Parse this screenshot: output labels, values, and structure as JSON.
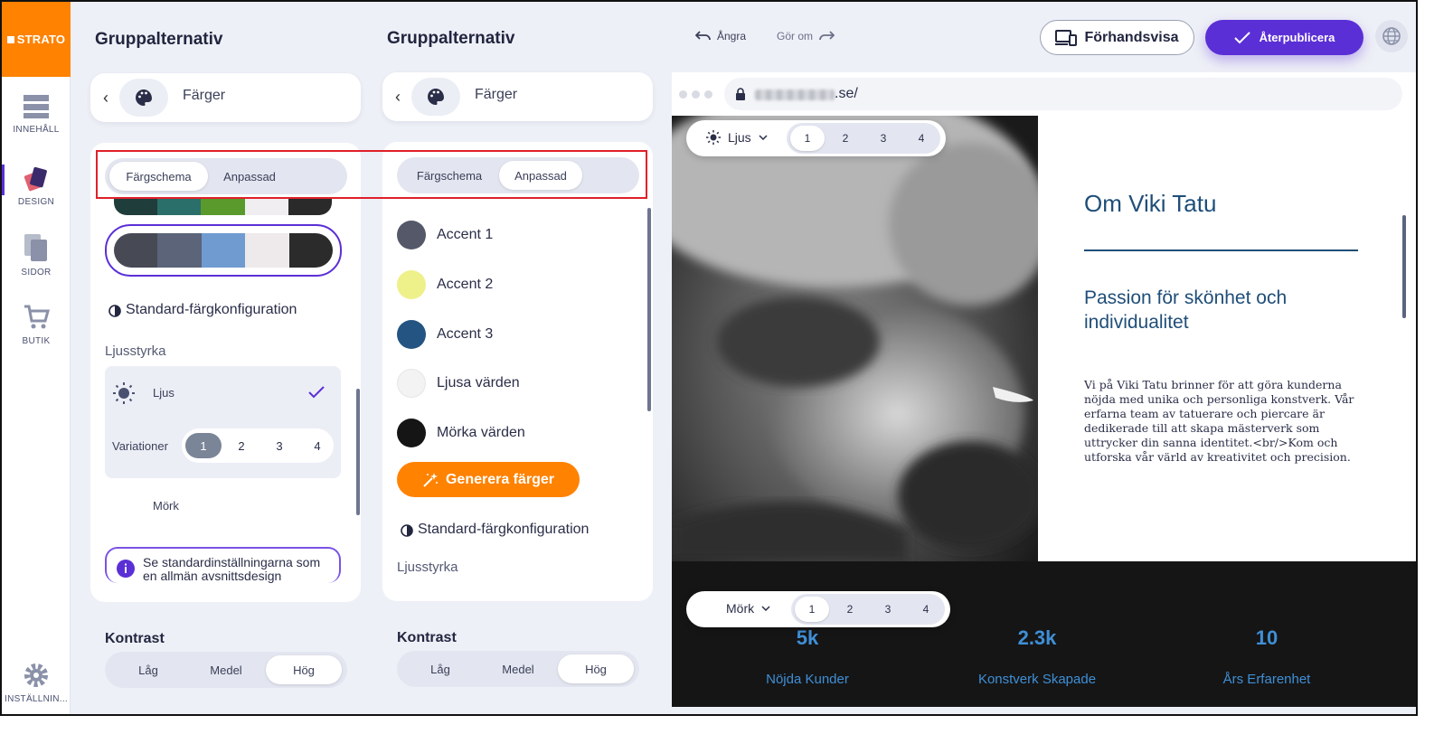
{
  "nav": {
    "logo": "STRATO",
    "items": [
      {
        "label": "INNEHÅLL"
      },
      {
        "label": "DESIGN"
      },
      {
        "label": "SIDOR"
      },
      {
        "label": "BUTIK"
      },
      {
        "label": "INSTÄLLNIN..."
      }
    ]
  },
  "left_panel": {
    "title": "Gruppalternativ",
    "back_label": "Färger",
    "tabs": [
      "Färgschema",
      "Anpassad"
    ],
    "active_tab": "Färgschema",
    "palette_top": [
      "#1f3d3b",
      "#2b6f6a",
      "#5a9a2c",
      "#f0eef0",
      "#2a2a2a"
    ],
    "palette_selected": [
      "#474a55",
      "#5b6478",
      "#6f9bd1",
      "#eee9ea",
      "#2b2b2b"
    ],
    "std_config": "Standard-färgkonfiguration",
    "brightness_label": "Ljusstyrka",
    "light_label": "Ljus",
    "variations_label": "Variationer",
    "variations": [
      "1",
      "2",
      "3",
      "4"
    ],
    "active_variation": "1",
    "dark_label": "Mörk",
    "info_text": "Se standardinställningarna som en allmän avsnittsdesign",
    "contrast_label": "Kontrast",
    "contrast_options": [
      "Låg",
      "Medel",
      "Hög"
    ],
    "active_contrast": "Hög"
  },
  "mid_panel": {
    "title": "Gruppalternativ",
    "back_label": "Färger",
    "tabs": [
      "Färgschema",
      "Anpassad"
    ],
    "active_tab": "Anpassad",
    "accents": [
      {
        "label": "Accent 1",
        "color": "#545869"
      },
      {
        "label": "Accent 2",
        "color": "#eef08a"
      },
      {
        "label": "Accent 3",
        "color": "#245482"
      },
      {
        "label": "Ljusa värden",
        "color": "#f3f3f3"
      },
      {
        "label": "Mörka värden",
        "color": "#151515"
      }
    ],
    "generate_label": "Generera färger",
    "std_config": "Standard-färgkonfiguration",
    "brightness_label": "Ljusstyrka",
    "contrast_label": "Kontrast",
    "contrast_options": [
      "Låg",
      "Medel",
      "Hög"
    ],
    "active_contrast": "Hög"
  },
  "topbar": {
    "undo": "Ångra",
    "redo": "Gör om",
    "preview": "Förhandsvisa",
    "publish": "Återpublicera"
  },
  "browser": {
    "url_suffix": ".se/"
  },
  "site": {
    "light_mode": {
      "label": "Ljus",
      "variations": [
        "1",
        "2",
        "3",
        "4"
      ],
      "active": "1"
    },
    "dark_mode": {
      "label": "Mörk",
      "variations": [
        "1",
        "2",
        "3",
        "4"
      ],
      "active": "1"
    },
    "heading": "Om Viki Tatu",
    "subheading": "Passion för skönhet och individualitet",
    "body": "Vi på Viki Tatu brinner för att göra kunderna nöjda med unika och personliga konstverk. Vår erfarna team av tatuerare och piercare är dedikerade till att skapa mästerverk som uttrycker din sanna identitet.<br/>Kom och utforska vår värld av kreativitet och precision.",
    "stats": [
      {
        "value": "5k",
        "label": "Nöjda Kunder"
      },
      {
        "value": "2.3k",
        "label": "Konstverk Skapade"
      },
      {
        "value": "10",
        "label": "Års Erfarenhet"
      }
    ],
    "accent_color": "#1f4e79",
    "stat_color": "#3f8fd6"
  },
  "colors": {
    "brand_orange": "#ff8200",
    "brand_purple": "#5b2fd6",
    "highlight_red": "#e0202a"
  }
}
